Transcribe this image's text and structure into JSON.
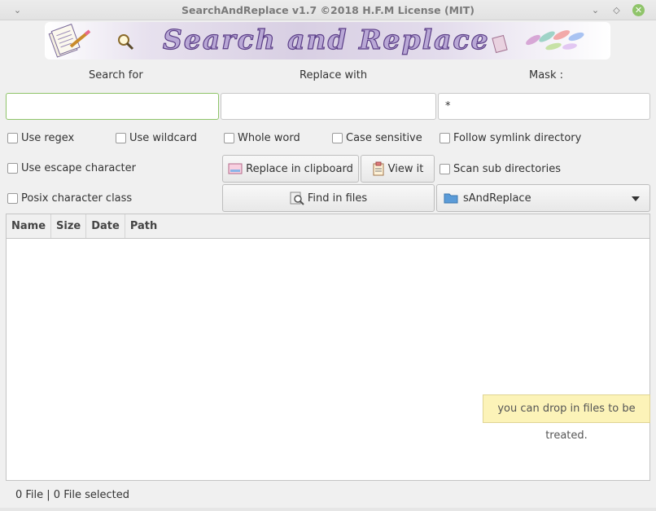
{
  "window": {
    "title": "SearchAndReplace v1.7  ©2018 H.F.M License (MIT)",
    "controls": {
      "menu": "⌄",
      "minimize": "⌄",
      "maximize": "◇",
      "close": "✕"
    }
  },
  "banner": {
    "text": "Search and Replace"
  },
  "labels": {
    "search_for": "Search for",
    "replace_with": "Replace with",
    "mask": "Mask :"
  },
  "inputs": {
    "search_value": "",
    "replace_value": "",
    "mask_value": "*"
  },
  "options": {
    "use_regex": "Use regex",
    "use_wildcard": "Use wildcard",
    "whole_word": "Whole word",
    "case_sensitive": "Case sensitive",
    "follow_symlink": "Follow symlink directory",
    "use_escape": "Use escape character",
    "scan_sub": "Scan sub directories",
    "posix_class": "Posix character class"
  },
  "buttons": {
    "replace_clipboard": "Replace in clipboard",
    "view_it": "View it",
    "find_in_files": "Find in files"
  },
  "directory": {
    "selected": "sAndReplace"
  },
  "table": {
    "columns": [
      "Name",
      "Size",
      "Date",
      "Path"
    ]
  },
  "tooltip": "you can drop in files to be treated.",
  "status": "0 File | 0 File selected",
  "colors": {
    "accent": "#8fc46a",
    "tooltip_bg": "#fcf3b8"
  }
}
